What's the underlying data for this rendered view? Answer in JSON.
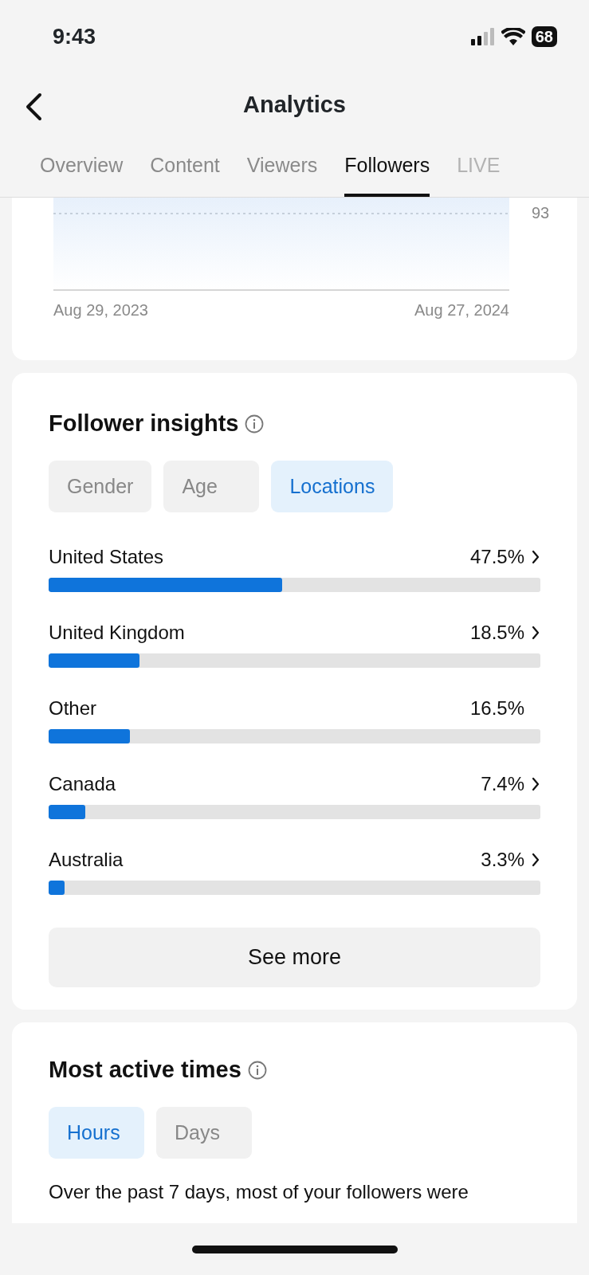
{
  "status_bar": {
    "time": "9:43",
    "battery": "68"
  },
  "header": {
    "title": "Analytics"
  },
  "tabs": [
    {
      "label": "Overview",
      "selected": false
    },
    {
      "label": "Content",
      "selected": false
    },
    {
      "label": "Viewers",
      "selected": false
    },
    {
      "label": "Followers",
      "selected": true
    },
    {
      "label": "LIVE",
      "selected": false
    }
  ],
  "follower_chart": {
    "y_label": "93",
    "x_start": "Aug 29, 2023",
    "x_end": "Aug 27, 2024"
  },
  "follower_insights": {
    "title": "Follower insights",
    "filters": [
      {
        "label": "Gender",
        "selected": false
      },
      {
        "label": "Age",
        "selected": false
      },
      {
        "label": "Locations",
        "selected": true
      }
    ],
    "locations": [
      {
        "name": "United States",
        "reading": "47.5%",
        "level": 0.475,
        "navigable": true
      },
      {
        "name": "United Kingdom",
        "reading": "18.5%",
        "level": 0.185,
        "navigable": true
      },
      {
        "name": "Other",
        "reading": "16.5%",
        "level": 0.165,
        "navigable": false
      },
      {
        "name": "Canada",
        "reading": "7.4%",
        "level": 0.074,
        "navigable": true
      },
      {
        "name": "Australia",
        "reading": "3.3%",
        "level": 0.033,
        "navigable": true
      }
    ],
    "see_more": "See more"
  },
  "most_active_times": {
    "title": "Most active times",
    "filters": [
      {
        "label": "Hours",
        "selected": true
      },
      {
        "label": "Days",
        "selected": false
      }
    ],
    "summary": "Over the past 7 days, most of your followers were"
  }
}
